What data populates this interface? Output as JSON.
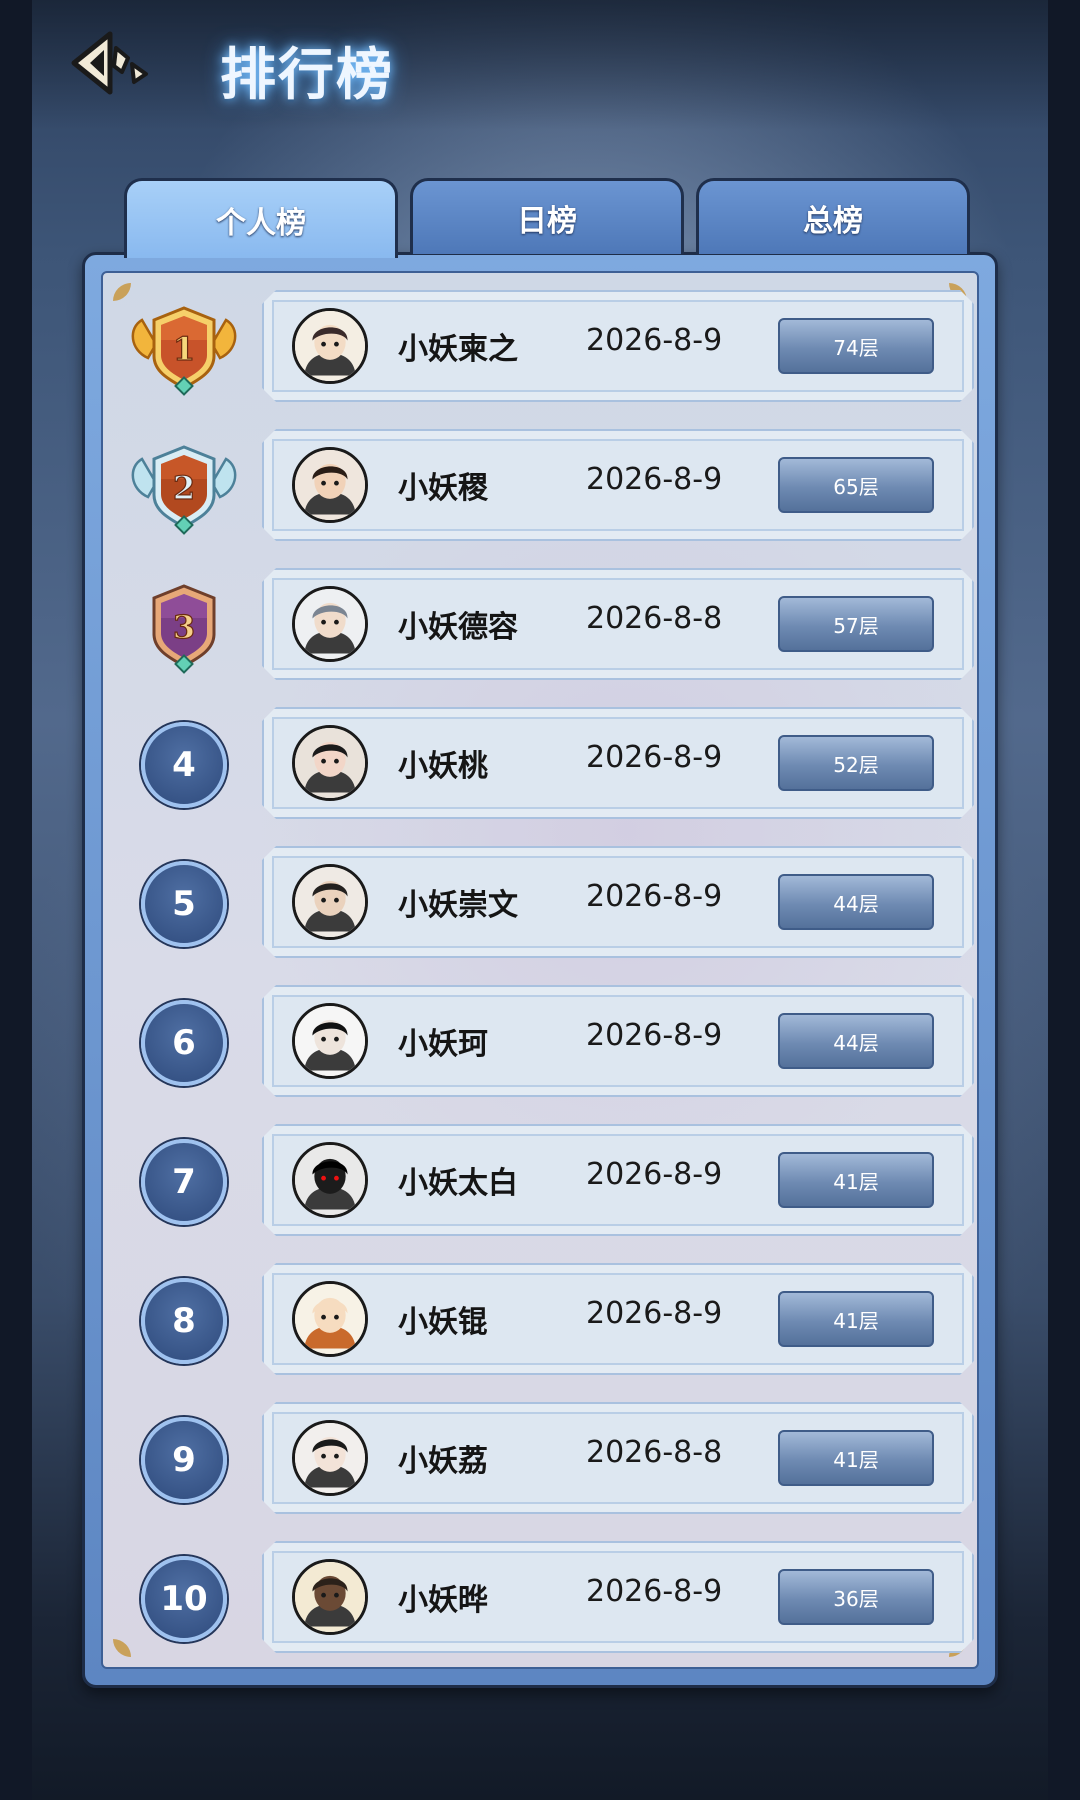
{
  "header": {
    "title": "排行榜"
  },
  "tabs": [
    {
      "label": "个人榜",
      "active": true
    },
    {
      "label": "日榜",
      "active": false
    },
    {
      "label": "总榜",
      "active": false
    }
  ],
  "colors": {
    "tab_active": "#a8d0f8",
    "tab_inactive": "#4e78b8",
    "rank_circle": "#3b5a8f",
    "score_badge": "#54719b"
  },
  "rows": [
    {
      "rank": "1",
      "name": "小妖柬之",
      "date": "2026-8-9",
      "score": "74层"
    },
    {
      "rank": "2",
      "name": "小妖稷",
      "date": "2026-8-9",
      "score": "65层"
    },
    {
      "rank": "3",
      "name": "小妖德容",
      "date": "2026-8-8",
      "score": "57层"
    },
    {
      "rank": "4",
      "name": "小妖桃",
      "date": "2026-8-9",
      "score": "52层"
    },
    {
      "rank": "5",
      "name": "小妖崇文",
      "date": "2026-8-9",
      "score": "44层"
    },
    {
      "rank": "6",
      "name": "小妖珂",
      "date": "2026-8-9",
      "score": "44层"
    },
    {
      "rank": "7",
      "name": "小妖太白",
      "date": "2026-8-9",
      "score": "41层"
    },
    {
      "rank": "8",
      "name": "小妖锟",
      "date": "2026-8-9",
      "score": "41层"
    },
    {
      "rank": "9",
      "name": "小妖荔",
      "date": "2026-8-8",
      "score": "41层"
    },
    {
      "rank": "10",
      "name": "小妖晔",
      "date": "2026-8-9",
      "score": "36层"
    }
  ]
}
